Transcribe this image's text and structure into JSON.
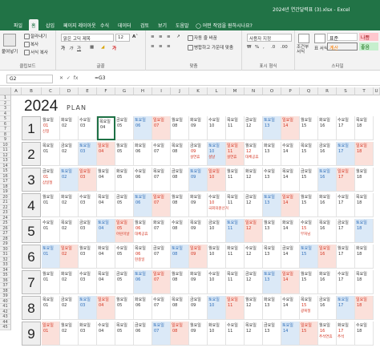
{
  "window": {
    "title": "2024년 연간달력표 (3).xlsx  -  Excel"
  },
  "tabs": [
    "파일",
    "홈",
    "삽입",
    "페이지 레이아웃",
    "수식",
    "데이터",
    "검토",
    "보기",
    "도움말"
  ],
  "tell_me": "어떤 작업을 원하시나요?",
  "ribbon": {
    "clipboard": {
      "paste": "붙여넣기",
      "cut": "잘라내기",
      "copy": "복사",
      "format_painter": "서식 복사",
      "label": "클립보드"
    },
    "font": {
      "font_name": "맑은 고딕 제목",
      "font_size": "12",
      "label": "글꼴"
    },
    "alignment": {
      "wrap": "자동 줄 바꿈",
      "merge": "병합하고 가운데 맞춤",
      "label": "맞춤"
    },
    "number": {
      "format": "사용자 지정",
      "label": "표시 형식"
    },
    "styles": {
      "conditional": "조건부 서식",
      "table": "표 서식",
      "normal": "표준",
      "bad": "나쁨",
      "calc": "계산",
      "good": "좋음",
      "label": "스타일"
    }
  },
  "formula_bar": {
    "name_box": "G2",
    "fx": "fx",
    "formula": "=G3"
  },
  "columns": [
    "A",
    "B",
    "C",
    "D",
    "E",
    "F",
    "G",
    "H",
    "I",
    "J",
    "K",
    "L",
    "M",
    "N",
    "O",
    "P",
    "Q",
    "R",
    "S",
    "T",
    "U",
    "V",
    "W",
    "X",
    "Y"
  ],
  "rows": [
    "1",
    "2",
    "3",
    "4",
    "5",
    "6",
    "7",
    "8",
    "9",
    "10",
    "11",
    "12",
    "13",
    "14",
    "15",
    "16",
    "17",
    "18",
    "19",
    "20",
    "21",
    "22",
    "23",
    "24",
    "25",
    "26",
    "27",
    "28",
    "29",
    "30",
    "31",
    "32",
    "33",
    "34",
    "35",
    "36",
    "37",
    "38",
    "39",
    "40",
    "41",
    "42",
    "43",
    "44",
    "45"
  ],
  "sheet": {
    "year": "2024",
    "plan": "PLAN"
  },
  "colors": {
    "excel_green": "#217346",
    "saturday": "#dbe9f7",
    "sunday": "#fbe0da",
    "holiday_red": "#d3321f",
    "saturday_blue": "#2e6db8"
  },
  "months": [
    {
      "label": "1",
      "start": 1,
      "days": [
        "월요일",
        "화요일",
        "수요일",
        "목요일",
        "금요일",
        "토요일",
        "일요일",
        "월요일",
        "화요일",
        "수요일",
        "목요일",
        "금요일",
        "토요일",
        "일요일",
        "월요일",
        "화요일",
        "수요일",
        "목요일"
      ],
      "nums": [
        "01",
        "02",
        "03",
        "04",
        "05",
        "06",
        "07",
        "08",
        "09",
        "10",
        "11",
        "12",
        "13",
        "14",
        "15",
        "16",
        "17",
        "18"
      ],
      "notes": {
        "0": "신정"
      }
    },
    {
      "label": "2",
      "start": 4,
      "days": [
        "목요일",
        "금요일",
        "토요일",
        "일요일",
        "월요일",
        "화요일",
        "수요일",
        "목요일",
        "금요일",
        "토요일",
        "일요일",
        "월요일",
        "화요일",
        "수요일",
        "목요일",
        "금요일",
        "토요일",
        "일요일"
      ],
      "nums": [
        "01",
        "02",
        "03",
        "04",
        "05",
        "06",
        "07",
        "08",
        "09",
        "10",
        "11",
        "12",
        "13",
        "14",
        "15",
        "16",
        "17",
        "18"
      ],
      "notes": {
        "8": "설연휴",
        "9": "설날",
        "10": "설연휴",
        "11": "대체공휴"
      }
    },
    {
      "label": "3",
      "start": 5,
      "days": [
        "금요일",
        "토요일",
        "일요일",
        "월요일",
        "화요일",
        "수요일",
        "목요일",
        "금요일",
        "토요일",
        "일요일",
        "월요일",
        "화요일",
        "수요일",
        "목요일",
        "금요일",
        "토요일",
        "일요일",
        "월요일"
      ],
      "nums": [
        "01",
        "02",
        "03",
        "04",
        "05",
        "06",
        "07",
        "08",
        "09",
        "10",
        "11",
        "12",
        "13",
        "14",
        "15",
        "16",
        "17",
        "18"
      ],
      "notes": {
        "0": "삼일절"
      }
    },
    {
      "label": "4",
      "start": 1,
      "days": [
        "월요일",
        "화요일",
        "수요일",
        "목요일",
        "금요일",
        "토요일",
        "일요일",
        "월요일",
        "화요일",
        "수요일",
        "목요일",
        "금요일",
        "토요일",
        "일요일",
        "월요일",
        "화요일",
        "수요일",
        "목요일"
      ],
      "nums": [
        "01",
        "02",
        "03",
        "04",
        "05",
        "06",
        "07",
        "08",
        "09",
        "10",
        "11",
        "12",
        "13",
        "14",
        "15",
        "16",
        "17",
        "18"
      ],
      "notes": {
        "9": "국회의원선거"
      }
    },
    {
      "label": "5",
      "start": 3,
      "days": [
        "수요일",
        "목요일",
        "금요일",
        "토요일",
        "일요일",
        "월요일",
        "화요일",
        "수요일",
        "목요일",
        "금요일",
        "토요일",
        "일요일",
        "월요일",
        "화요일",
        "수요일",
        "목요일",
        "금요일",
        "토요일"
      ],
      "nums": [
        "01",
        "02",
        "03",
        "04",
        "05",
        "06",
        "07",
        "08",
        "09",
        "10",
        "11",
        "12",
        "13",
        "14",
        "15",
        "16",
        "17",
        "18"
      ],
      "notes": {
        "4": "어린이날",
        "5": "대체공휴",
        "14": "부처님"
      }
    },
    {
      "label": "6",
      "start": 6,
      "days": [
        "토요일",
        "일요일",
        "월요일",
        "화요일",
        "수요일",
        "목요일",
        "금요일",
        "토요일",
        "일요일",
        "월요일",
        "화요일",
        "수요일",
        "목요일",
        "금요일",
        "토요일",
        "일요일",
        "월요일",
        "화요일"
      ],
      "nums": [
        "01",
        "02",
        "03",
        "04",
        "05",
        "06",
        "07",
        "08",
        "09",
        "10",
        "11",
        "12",
        "13",
        "14",
        "15",
        "16",
        "17",
        "18"
      ],
      "notes": {
        "5": "현충일"
      }
    },
    {
      "label": "7",
      "start": 1,
      "days": [
        "월요일",
        "화요일",
        "수요일",
        "목요일",
        "금요일",
        "토요일",
        "일요일",
        "월요일",
        "화요일",
        "수요일",
        "목요일",
        "금요일",
        "토요일",
        "일요일",
        "월요일",
        "화요일",
        "수요일",
        "목요일"
      ],
      "nums": [
        "01",
        "02",
        "03",
        "04",
        "05",
        "06",
        "07",
        "08",
        "09",
        "10",
        "11",
        "12",
        "13",
        "14",
        "15",
        "16",
        "17",
        "18"
      ],
      "notes": {}
    },
    {
      "label": "8",
      "start": 4,
      "days": [
        "목요일",
        "금요일",
        "토요일",
        "일요일",
        "월요일",
        "화요일",
        "수요일",
        "목요일",
        "금요일",
        "토요일",
        "일요일",
        "월요일",
        "화요일",
        "수요일",
        "목요일",
        "금요일",
        "토요일",
        "일요일"
      ],
      "nums": [
        "01",
        "02",
        "03",
        "04",
        "05",
        "06",
        "07",
        "08",
        "09",
        "10",
        "11",
        "12",
        "13",
        "14",
        "15",
        "16",
        "17",
        "18"
      ],
      "notes": {
        "14": "광복절"
      }
    },
    {
      "label": "9",
      "start": 7,
      "days": [
        "일요일",
        "월요일",
        "화요일",
        "수요일",
        "목요일",
        "금요일",
        "토요일",
        "일요일",
        "월요일",
        "화요일",
        "수요일",
        "목요일",
        "금요일",
        "토요일",
        "일요일",
        "월요일",
        "화요일",
        "수요일"
      ],
      "nums": [
        "01",
        "02",
        "03",
        "04",
        "05",
        "06",
        "07",
        "08",
        "09",
        "10",
        "11",
        "12",
        "13",
        "14",
        "15",
        "16",
        "17",
        "18"
      ],
      "notes": {
        "15": "추석연휴",
        "16": "추석"
      }
    }
  ]
}
